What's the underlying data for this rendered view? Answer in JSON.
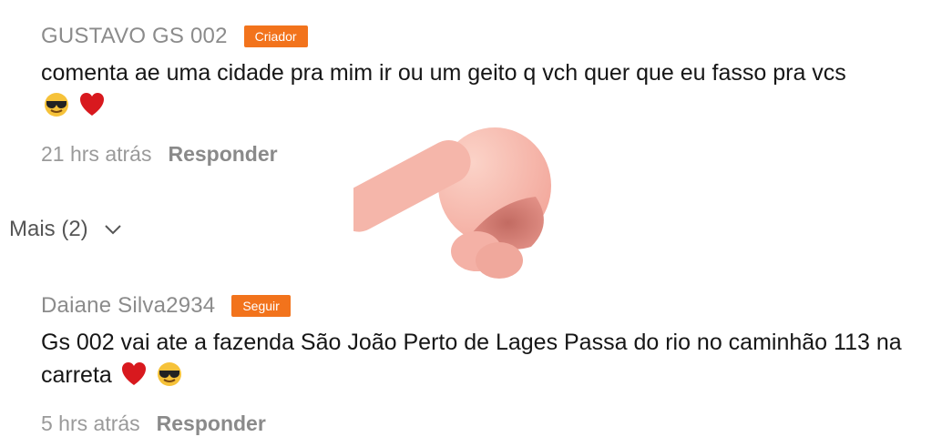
{
  "comments": [
    {
      "username": "GUSTAVO GS 002",
      "badge": "Criador",
      "text": "comenta ae uma cidade pra mim ir  ou um geito q vch quer que eu fasso pra vcs",
      "emojis": [
        "sunglasses-emoji",
        "red-heart-emoji"
      ],
      "time": "21 hrs atrás",
      "reply": "Responder"
    },
    {
      "username": "Daiane Silva2934",
      "badge": "Seguir",
      "text": "Gs 002 vai ate a fazenda São João  Perto de Lages  Passa do rio no caminhão 113 na carreta",
      "emojis": [
        "red-heart-emoji",
        "sunglasses-emoji"
      ],
      "time": "5 hrs atrás",
      "reply": "Responder"
    }
  ],
  "more_replies": "Mais (2)",
  "colors": {
    "badge": "#f2731c",
    "username": "#8b8b8b",
    "text": "#161616"
  },
  "icons": [
    "chevron-down-icon",
    "pointing-hand-sticker"
  ]
}
